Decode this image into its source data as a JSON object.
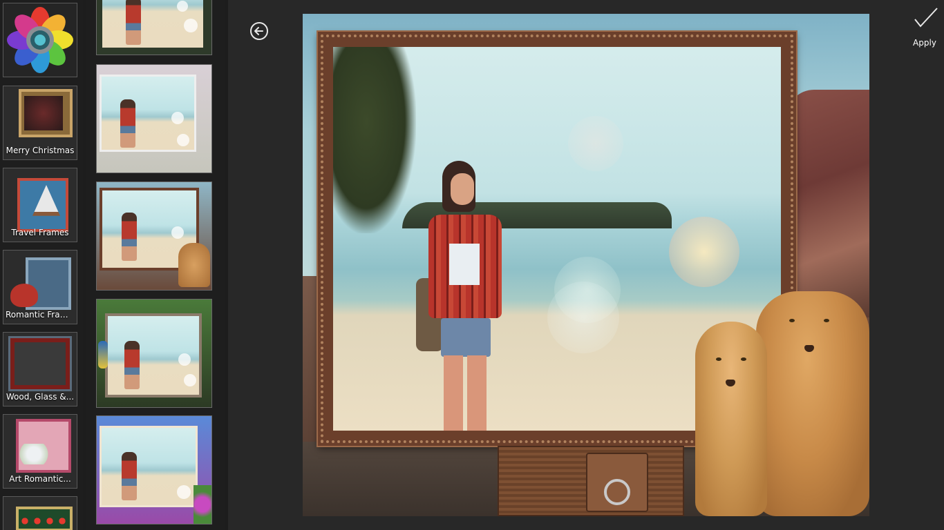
{
  "categories": [
    {
      "label": "",
      "icon": "app-logo-flower"
    },
    {
      "label": "Merry Christmas"
    },
    {
      "label": "Travel Frames"
    },
    {
      "label": "Romantic Frames"
    },
    {
      "label": "Wood, Glass &..."
    },
    {
      "label": "Art Romantic..."
    },
    {
      "label": ""
    }
  ],
  "toolbar": {
    "back_icon": "back-arrow-icon",
    "apply_label": "Apply",
    "apply_icon": "checkmark-icon"
  },
  "colors": {
    "background": "#1d1d1d",
    "panel": "#282828",
    "frame_wood": "#6b3f2b"
  }
}
